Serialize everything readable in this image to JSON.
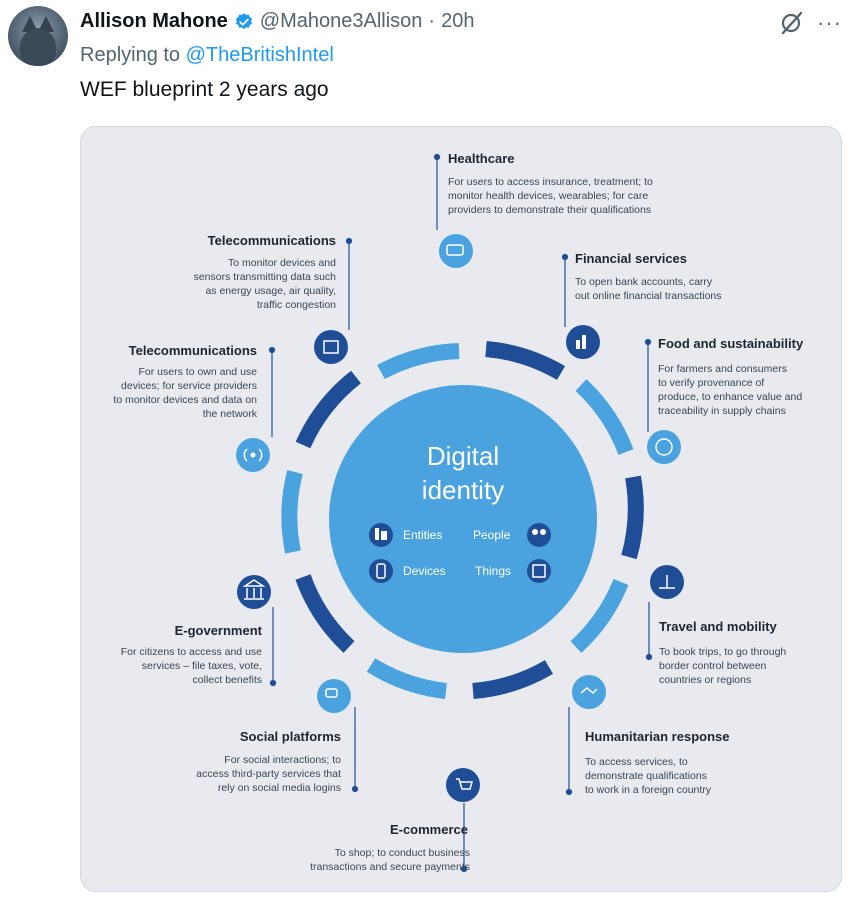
{
  "tweet": {
    "author_name": "Allison Mahone",
    "handle": "@Mahone3Allison",
    "separator": "·",
    "time": "20h",
    "replying_prefix": "Replying to ",
    "replying_to": "@TheBritishIntel",
    "text": "WEF blueprint 2 years ago",
    "verified_color": "#1d9bf0",
    "icons": [
      "grok-icon",
      "more-icon"
    ]
  },
  "infographic": {
    "center_title_line1": "Digital",
    "center_title_line2": "identity",
    "center_items": [
      "Entities",
      "People",
      "Devices",
      "Things"
    ],
    "colors": {
      "light_blue": "#4aa3df",
      "dark_blue": "#1f4e96",
      "bg": "#e8eaef",
      "text": "#1d2530"
    },
    "sections": [
      {
        "title": "Healthcare",
        "lines": [
          "For users to access insurance, treatment; to",
          "monitor health devices, wearables; for care",
          "providers to demonstrate their qualifications"
        ]
      },
      {
        "title": "Financial services",
        "lines": [
          "To open bank accounts, carry",
          "out online financial transactions"
        ]
      },
      {
        "title": "Food and sustainability",
        "lines": [
          "For farmers and consumers",
          "to verify provenance of",
          "produce, to enhance value and",
          "traceability in supply chains"
        ]
      },
      {
        "title": "Travel and mobility",
        "lines": [
          "To book trips, to go through",
          "border control between",
          "countries or regions"
        ]
      },
      {
        "title": "Humanitarian response",
        "lines": [
          "To access services, to",
          "demonstrate qualifications",
          "to work in a foreign country"
        ]
      },
      {
        "title": "E-commerce",
        "lines": [
          "To shop; to conduct business",
          "transactions and secure payments"
        ]
      },
      {
        "title": "Social platforms",
        "lines": [
          "For social interactions; to",
          "access third-party services that",
          "rely on social media logins"
        ]
      },
      {
        "title": "E-government",
        "lines": [
          "For citizens to access and use",
          "services – file taxes, vote,",
          "collect benefits"
        ]
      },
      {
        "title": "Telecommunications",
        "lines": [
          "For users to own and use",
          "devices; for service providers",
          "to monitor devices and data on",
          "the network"
        ]
      },
      {
        "title": "Telecommunications",
        "lines": [
          "To monitor devices and",
          "sensors transmitting data such",
          "as energy usage, air quality,",
          "traffic congestion"
        ]
      }
    ]
  }
}
